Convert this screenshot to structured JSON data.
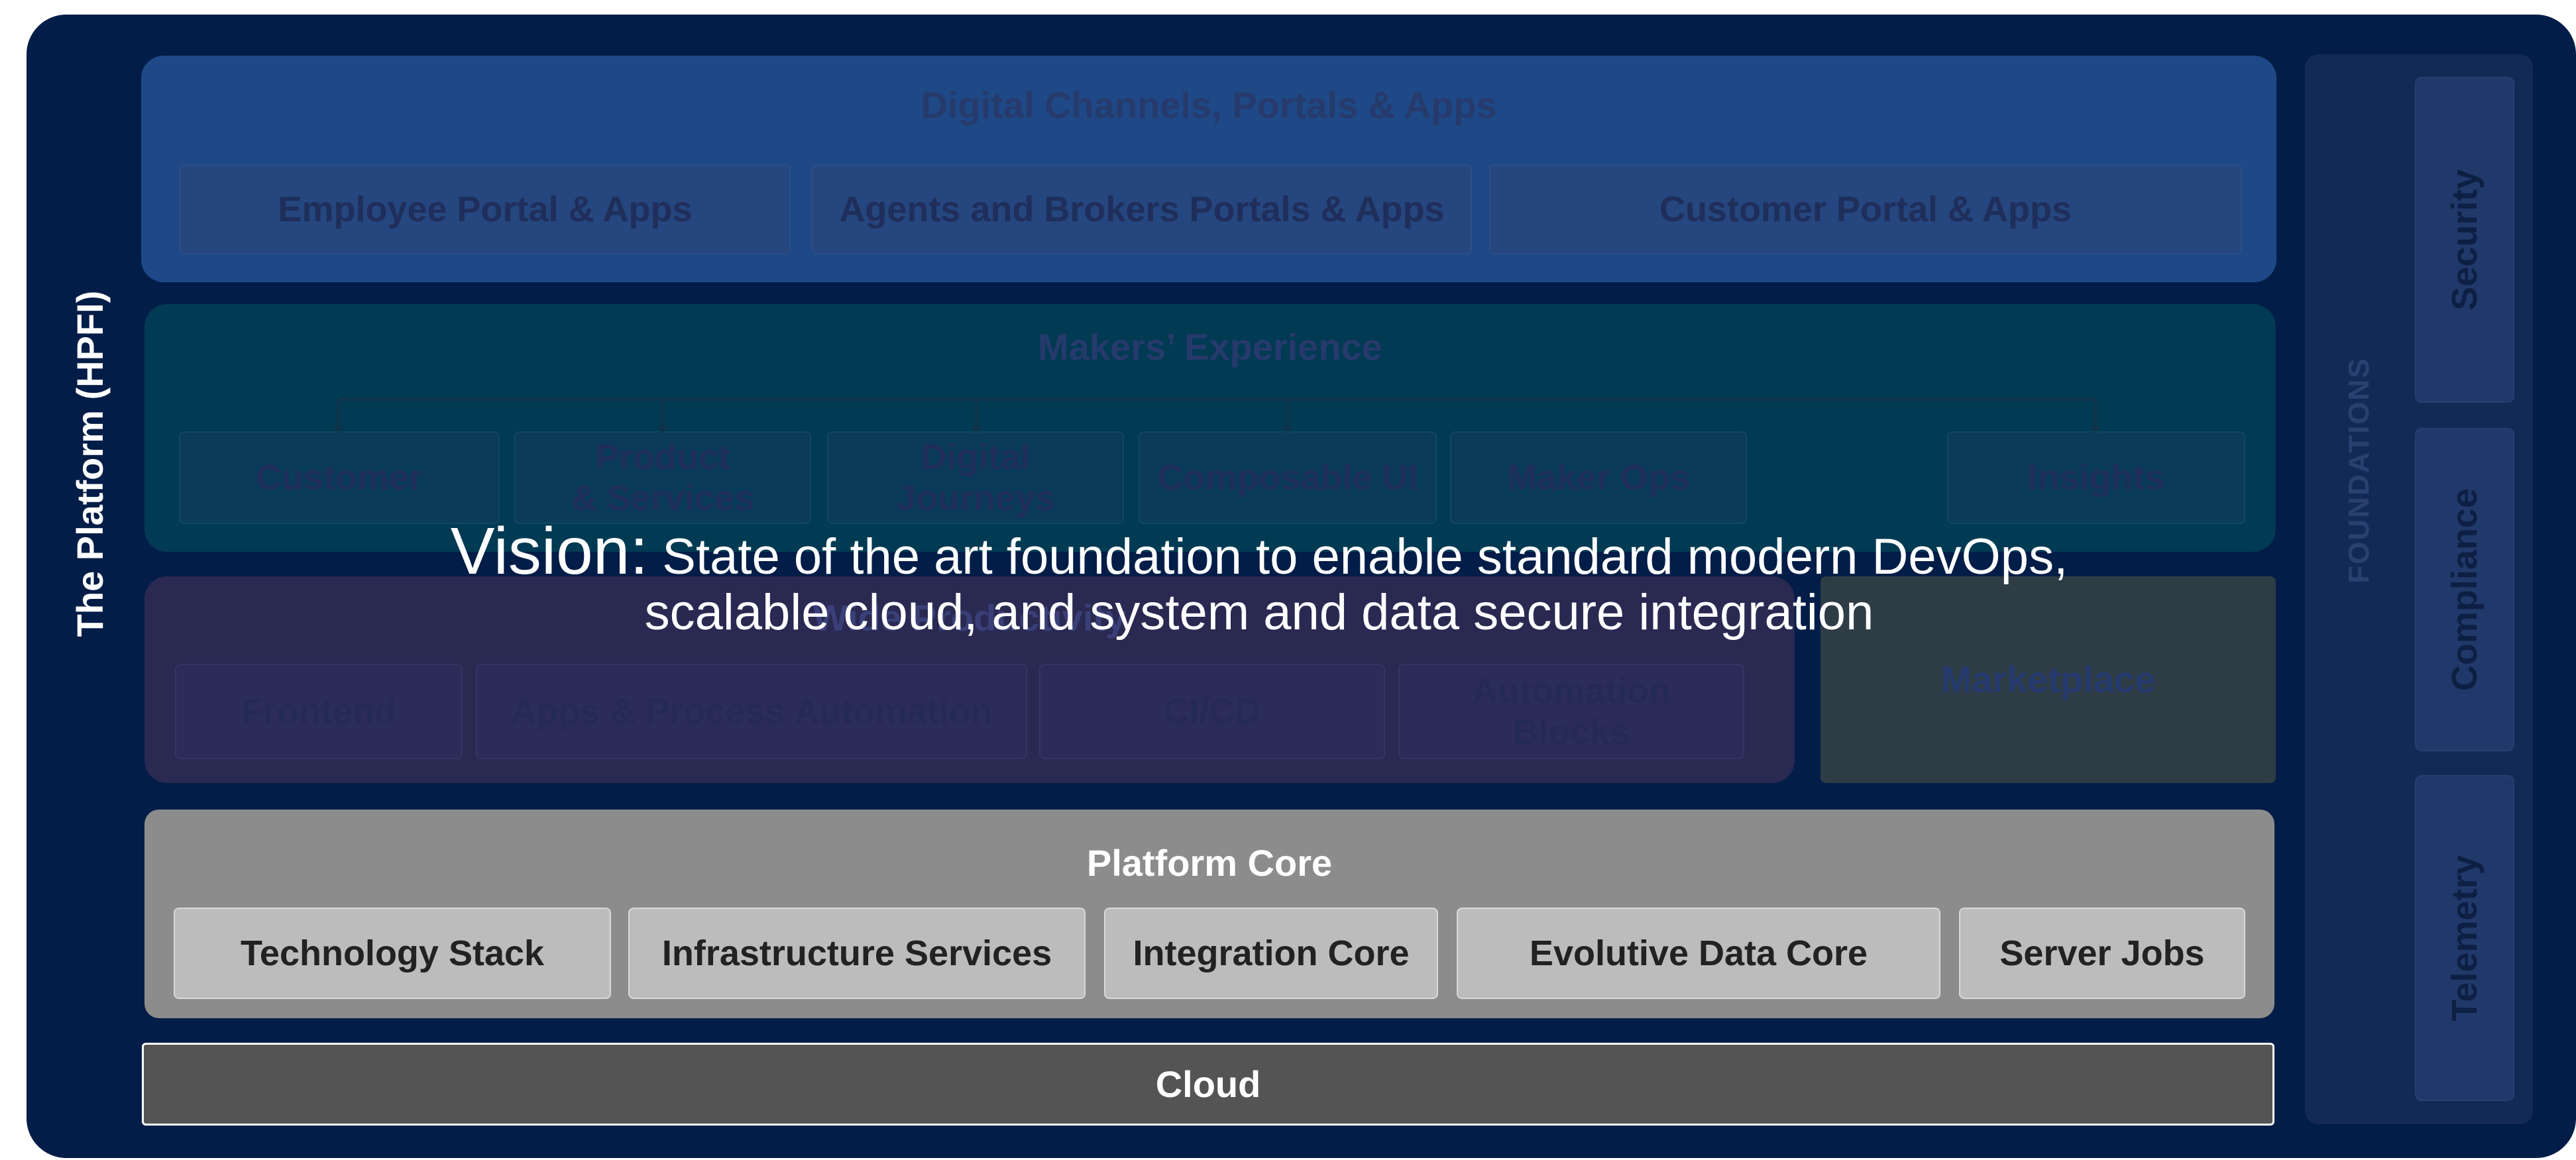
{
  "platform_title": "The Platform (HPFI)",
  "channels": {
    "title": "Digital Channels, Portals & Apps",
    "items": [
      "Employee Portal & Apps",
      "Agents and Brokers Portals & Apps",
      "Customer Portal & Apps"
    ]
  },
  "makers": {
    "title": "Makers’ Experience",
    "items": [
      "Customer",
      "Product\n& Services",
      "Digital\nJourneys",
      "Composable UI",
      "Maker Ops",
      "Insights"
    ]
  },
  "wide": {
    "title": "Wide Productivity",
    "items": [
      "Frontend",
      "Apps & Process Automation",
      "CI/CD",
      "Automation\nBlocks"
    ]
  },
  "marketplace": "Marketplace",
  "core": {
    "title": "Platform Core",
    "items": [
      "Technology Stack",
      "Infrastructure Services",
      "Integration Core",
      "Evolutive Data Core",
      "Server Jobs"
    ]
  },
  "cloud": "Cloud",
  "foundations": {
    "label": "FOUNDATIONS",
    "items": [
      "Security",
      "Compliance",
      "Telemetry"
    ]
  },
  "vision": {
    "lead": "Vision:",
    "text": "State of the art foundation to enable standard modern DevOps, scalable cloud, and system and data secure integration"
  },
  "colors": {
    "background": "#021d47",
    "platform_core": "#8c8c8c",
    "cloud": "#545454"
  }
}
